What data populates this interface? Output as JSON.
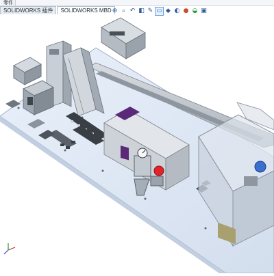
{
  "window": {
    "top_tabs": [
      "零件"
    ],
    "tabs": [
      {
        "label": "SOLIDWORKS 插件",
        "active": false
      },
      {
        "label": "SOLIDWORKS MBD",
        "active": true
      }
    ]
  },
  "view_toolbar": {
    "icons": [
      "zoom-to-fit-icon",
      "zoom-area-icon",
      "previous-view-icon",
      "section-view-icon",
      "dynamic-annotation-icon",
      "view-orientation-icon",
      "display-style-icon",
      "hide-show-icon",
      "edit-appearance-icon",
      "apply-scene-icon",
      "view-settings-icon"
    ]
  },
  "colors": {
    "plate": "#dfe9f6",
    "metal": "#b9c0c8",
    "dark": "#3a3f46",
    "accent_red": "#e0242a",
    "accent_purple": "#5a2a78",
    "accent_blue": "#3a6fd0"
  }
}
